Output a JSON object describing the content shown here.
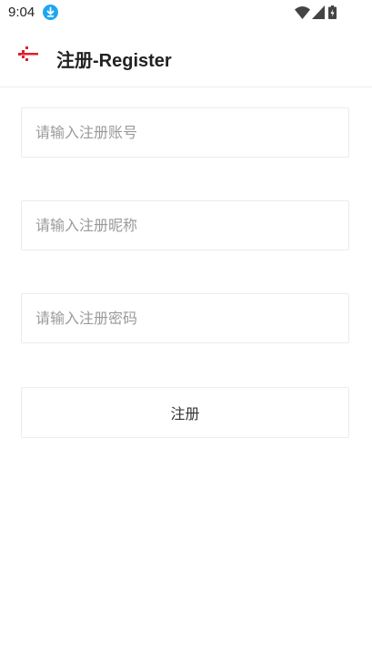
{
  "status_bar": {
    "time": "9:04",
    "icons": [
      "download-icon",
      "wifi-icon",
      "signal-icon",
      "battery-icon"
    ]
  },
  "header": {
    "title": "注册-Register",
    "back_icon": "back-arrow-icon"
  },
  "form": {
    "account_placeholder": "请输入注册账号",
    "nickname_placeholder": "请输入注册昵称",
    "password_placeholder": "请输入注册密码",
    "submit_label": "注册"
  },
  "colors": {
    "accent": "#e0202a",
    "download_badge": "#1ea7f0",
    "border": "#ececec",
    "placeholder": "#9a9a9a"
  }
}
